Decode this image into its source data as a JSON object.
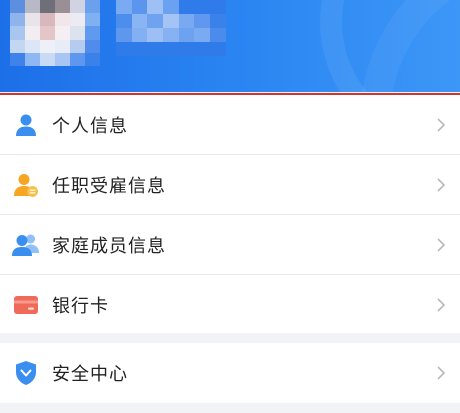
{
  "header": {
    "avatar_alt": "avatar",
    "name_blurred": ""
  },
  "menu": {
    "items": [
      {
        "label": "个人信息",
        "icon": "person-icon"
      },
      {
        "label": "任职受雇信息",
        "icon": "employment-icon"
      },
      {
        "label": "家庭成员信息",
        "icon": "family-icon"
      },
      {
        "label": "银行卡",
        "icon": "bank-card-icon"
      }
    ],
    "security": {
      "label": "安全中心",
      "icon": "shield-icon"
    }
  },
  "colors": {
    "header_start": "#1d6fe8",
    "header_end": "#3d97f7",
    "accent_blue": "#3a8ef0",
    "orange": "#f5a623",
    "card_red": "#f06a5a",
    "highlight_red": "#d0342c"
  }
}
